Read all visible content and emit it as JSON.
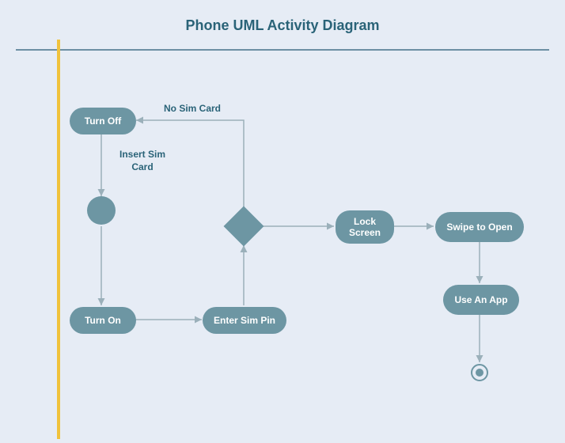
{
  "title": "Phone UML Activity Diagram",
  "nodes": {
    "turn_off": "Turn Off",
    "insert_sim": "Insert Sim\nCard",
    "turn_on": "Turn On",
    "enter_pin": "Enter Sim Pin",
    "no_sim": "No Sim Card",
    "lock_screen": "Lock\nScreen",
    "swipe": "Swipe to Open",
    "use_app": "Use An App"
  },
  "chart_data": {
    "type": "diagram",
    "diagram_type": "uml-activity",
    "title": "Phone UML Activity Diagram",
    "nodes": [
      {
        "id": "turn_off",
        "type": "activity",
        "label": "Turn Off"
      },
      {
        "id": "initial",
        "type": "initial",
        "label": ""
      },
      {
        "id": "turn_on",
        "type": "activity",
        "label": "Turn On"
      },
      {
        "id": "enter_pin",
        "type": "activity",
        "label": "Enter Sim Pin"
      },
      {
        "id": "decision",
        "type": "decision",
        "label": ""
      },
      {
        "id": "lock_screen",
        "type": "activity",
        "label": "Lock Screen"
      },
      {
        "id": "swipe",
        "type": "activity",
        "label": "Swipe to Open"
      },
      {
        "id": "use_app",
        "type": "activity",
        "label": "Use An App"
      },
      {
        "id": "final",
        "type": "final",
        "label": ""
      }
    ],
    "edges": [
      {
        "from": "turn_off",
        "to": "initial",
        "label": "Insert Sim Card"
      },
      {
        "from": "initial",
        "to": "turn_on",
        "label": ""
      },
      {
        "from": "turn_on",
        "to": "enter_pin",
        "label": ""
      },
      {
        "from": "enter_pin",
        "to": "decision",
        "label": ""
      },
      {
        "from": "decision",
        "to": "turn_off",
        "label": "No Sim Card"
      },
      {
        "from": "decision",
        "to": "lock_screen",
        "label": ""
      },
      {
        "from": "lock_screen",
        "to": "swipe",
        "label": ""
      },
      {
        "from": "swipe",
        "to": "use_app",
        "label": ""
      },
      {
        "from": "use_app",
        "to": "final",
        "label": ""
      }
    ]
  }
}
